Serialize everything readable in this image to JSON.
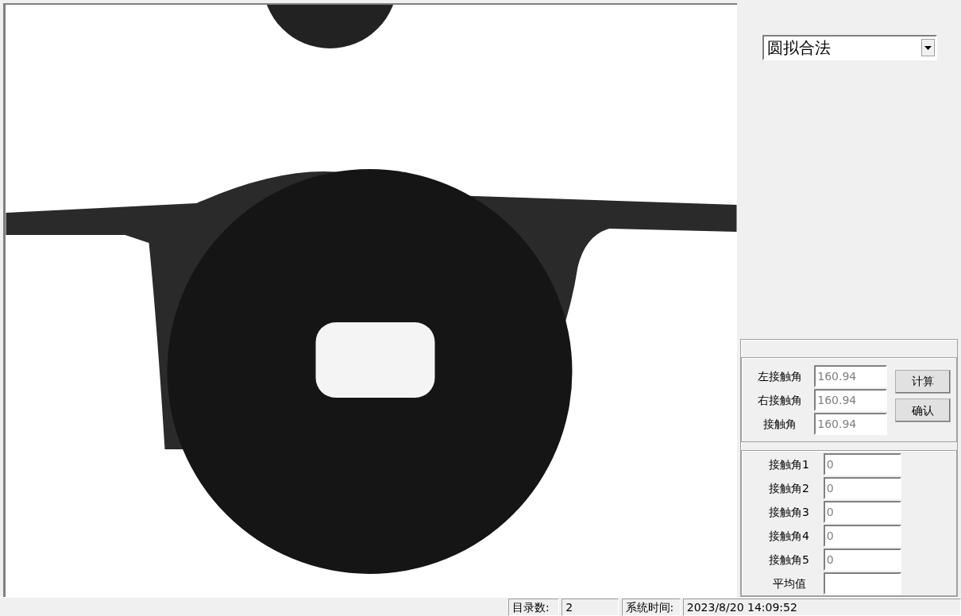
{
  "method_select": {
    "value": "圆拟合法"
  },
  "angles": [
    {
      "label": "左接触角",
      "value": "160.94",
      "disabled": true
    },
    {
      "label": "右接触角",
      "value": "160.94",
      "disabled": true
    },
    {
      "label": "接触角",
      "value": "160.94",
      "disabled": true
    }
  ],
  "buttons": [
    "计算",
    "确认"
  ],
  "records": [
    {
      "label": "接触角1",
      "value": "0",
      "disabled": true
    },
    {
      "label": "接触角2",
      "value": "0",
      "disabled": true
    },
    {
      "label": "接触角3",
      "value": "0",
      "disabled": true
    },
    {
      "label": "接触角4",
      "value": "0",
      "disabled": true
    },
    {
      "label": "接触角5",
      "value": "0",
      "disabled": true
    },
    {
      "label": "平均值",
      "disabled": true
    }
  ],
  "status_bar": {
    "count_label": "目录数:",
    "count": "2",
    "time_label": "系统时间:",
    "time": "2023/8/20 14:09:52"
  }
}
